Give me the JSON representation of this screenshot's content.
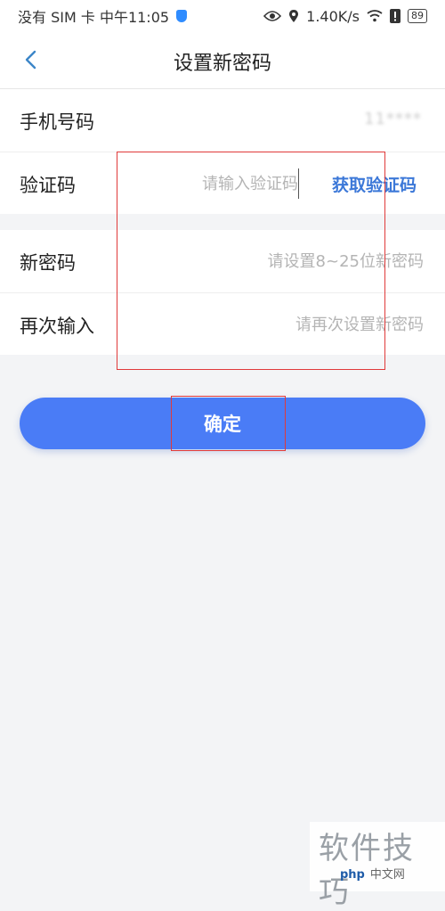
{
  "status_bar": {
    "left_text": "没有 SIM 卡 中午11:05",
    "speed": "1.40K/s",
    "battery": "89",
    "icons": [
      "shield-icon",
      "eye-icon",
      "location-icon",
      "wifi-icon",
      "alert-icon",
      "battery-icon"
    ]
  },
  "header": {
    "title": "设置新密码",
    "back_icon": "chevron-left-icon"
  },
  "form": {
    "phone": {
      "label": "手机号码",
      "value": "11****"
    },
    "code": {
      "label": "验证码",
      "placeholder": "请输入验证码",
      "get_code_label": "获取验证码"
    },
    "new_password": {
      "label": "新密码",
      "placeholder": "请设置8~25位新密码"
    },
    "repeat_password": {
      "label": "再次输入",
      "placeholder": "请再次设置新密码"
    }
  },
  "confirm_button": {
    "label": "确定"
  },
  "colors": {
    "accent": "#4a7cf6",
    "link": "#3c78d8",
    "annotation": "#e03a3a",
    "background": "#f3f4f6"
  },
  "watermark": {
    "text": "软件技巧",
    "brand": "php",
    "site": "中文网"
  }
}
